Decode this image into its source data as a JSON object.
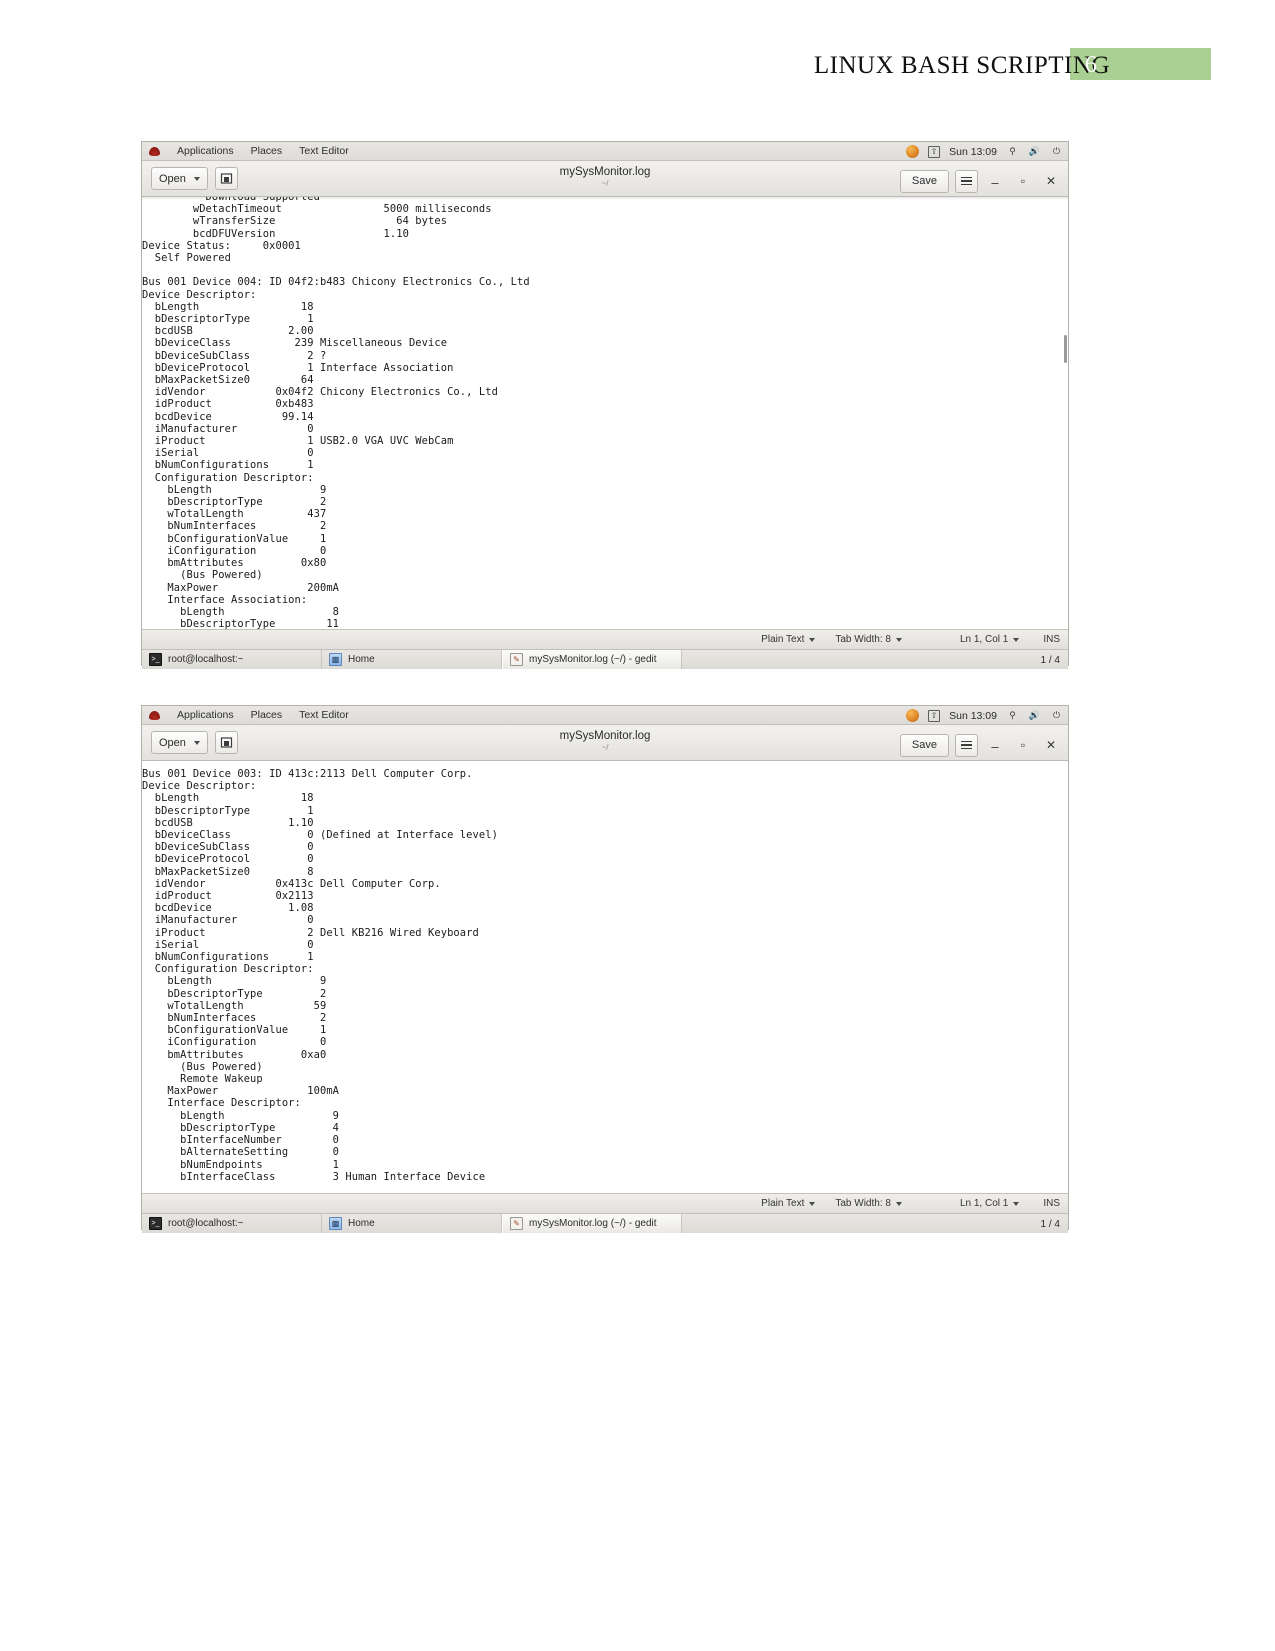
{
  "page": {
    "doc_title": "LINUX BASH SCRIPTING",
    "page_number": "6",
    "accent_color": "#a9cf93"
  },
  "windows": [
    {
      "panel": {
        "menu": [
          "Applications",
          "Places",
          "Text Editor"
        ],
        "clock": "Sun 13:09",
        "tray_icons": [
          "redhat-icon",
          "orange-circle-icon",
          "screenshot-icon",
          "network-icon",
          "volume-icon",
          "power-icon"
        ]
      },
      "headerbar": {
        "open_label": "Open",
        "open_icon": "chevron-down-icon",
        "new_doc_icon": "new-document-icon",
        "title": "mySysMonitor.log",
        "subtitle": "~/",
        "save_label": "Save",
        "menu_icon": "hamburger-icon",
        "minimize_label": "–",
        "maximize_label": "▫",
        "close_label": "✕"
      },
      "editor_text": "          Download Supported\n        wDetachTimeout                5000 milliseconds\n        wTransferSize                   64 bytes\n        bcdDFUVersion                 1.10\nDevice Status:     0x0001\n  Self Powered\n\nBus 001 Device 004: ID 04f2:b483 Chicony Electronics Co., Ltd\nDevice Descriptor:\n  bLength                18\n  bDescriptorType         1\n  bcdUSB               2.00\n  bDeviceClass          239 Miscellaneous Device\n  bDeviceSubClass         2 ?\n  bDeviceProtocol         1 Interface Association\n  bMaxPacketSize0        64\n  idVendor           0x04f2 Chicony Electronics Co., Ltd\n  idProduct          0xb483\n  bcdDevice           99.14\n  iManufacturer           0\n  iProduct                1 USB2.0 VGA UVC WebCam\n  iSerial                 0\n  bNumConfigurations      1\n  Configuration Descriptor:\n    bLength                 9\n    bDescriptorType         2\n    wTotalLength          437\n    bNumInterfaces          2\n    bConfigurationValue     1\n    iConfiguration          0\n    bmAttributes         0x80\n      (Bus Powered)\n    MaxPower              200mA\n    Interface Association:\n      bLength                 8\n      bDescriptorType        11",
      "statusbar": {
        "language": "Plain Text",
        "tab_width": "Tab Width: 8",
        "position": "Ln 1, Col 1",
        "insert_mode": "INS"
      },
      "taskbar": {
        "items": [
          {
            "label": "root@localhost:~",
            "icon": "terminal-icon"
          },
          {
            "label": "Home",
            "icon": "folder-icon"
          },
          {
            "label": "mySysMonitor.log (~/) - gedit",
            "icon": "gedit-icon"
          }
        ],
        "workspace": "1 / 4"
      }
    },
    {
      "panel": {
        "menu": [
          "Applications",
          "Places",
          "Text Editor"
        ],
        "clock": "Sun 13:09",
        "tray_icons": [
          "redhat-icon",
          "orange-circle-icon",
          "screenshot-icon",
          "network-icon",
          "volume-icon",
          "power-icon"
        ]
      },
      "headerbar": {
        "open_label": "Open",
        "open_icon": "chevron-down-icon",
        "new_doc_icon": "new-document-icon",
        "title": "mySysMonitor.log",
        "subtitle": "~/",
        "save_label": "Save",
        "menu_icon": "hamburger-icon",
        "minimize_label": "–",
        "maximize_label": "▫",
        "close_label": "✕"
      },
      "editor_text": "Bus 001 Device 003: ID 413c:2113 Dell Computer Corp.\nDevice Descriptor:\n  bLength                18\n  bDescriptorType         1\n  bcdUSB               1.10\n  bDeviceClass            0 (Defined at Interface level)\n  bDeviceSubClass         0\n  bDeviceProtocol         0\n  bMaxPacketSize0         8\n  idVendor           0x413c Dell Computer Corp.\n  idProduct          0x2113\n  bcdDevice            1.08\n  iManufacturer           0\n  iProduct                2 Dell KB216 Wired Keyboard\n  iSerial                 0\n  bNumConfigurations      1\n  Configuration Descriptor:\n    bLength                 9\n    bDescriptorType         2\n    wTotalLength           59\n    bNumInterfaces          2\n    bConfigurationValue     1\n    iConfiguration          0\n    bmAttributes         0xa0\n      (Bus Powered)\n      Remote Wakeup\n    MaxPower              100mA\n    Interface Descriptor:\n      bLength                 9\n      bDescriptorType         4\n      bInterfaceNumber        0\n      bAlternateSetting       0\n      bNumEndpoints           1\n      bInterfaceClass         3 Human Interface Device",
      "statusbar": {
        "language": "Plain Text",
        "tab_width": "Tab Width: 8",
        "position": "Ln 1, Col 1",
        "insert_mode": "INS"
      },
      "taskbar": {
        "items": [
          {
            "label": "root@localhost:~",
            "icon": "terminal-icon"
          },
          {
            "label": "Home",
            "icon": "folder-icon"
          },
          {
            "label": "mySysMonitor.log (~/) - gedit",
            "icon": "gedit-icon"
          }
        ],
        "workspace": "1 / 4"
      }
    }
  ]
}
